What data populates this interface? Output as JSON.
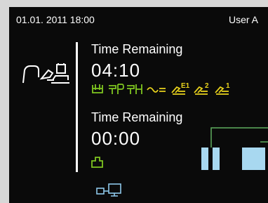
{
  "header": {
    "datetime": "01.01. 2011 18:00",
    "user": "User A"
  },
  "program1": {
    "title": "Time Remaining",
    "time": "04:10",
    "step_icons": [
      "basket-icon",
      "spray-arm-icon",
      "spray-arm-hot-icon",
      "flow-icon",
      "rinse-e1-icon",
      "rinse-2-icon",
      "rinse-1-icon"
    ],
    "e1_label": "E1",
    "r2_label": "2",
    "r1_label": "1"
  },
  "program2": {
    "title": "Time Remaining",
    "time": "00:00",
    "step_icons": [
      "load-icon"
    ]
  },
  "controls": {
    "pause": "pause-button",
    "stop": "stop-button"
  },
  "colors": {
    "background": "#0a0a0a",
    "frame": "#d7d7d7",
    "text": "#ffffff",
    "step_green": "#7fc520",
    "step_yellow": "#e8d21c",
    "control_blue": "#a8d8f0",
    "connector": "#5fae5f",
    "network_blue": "#8ec8ea"
  }
}
